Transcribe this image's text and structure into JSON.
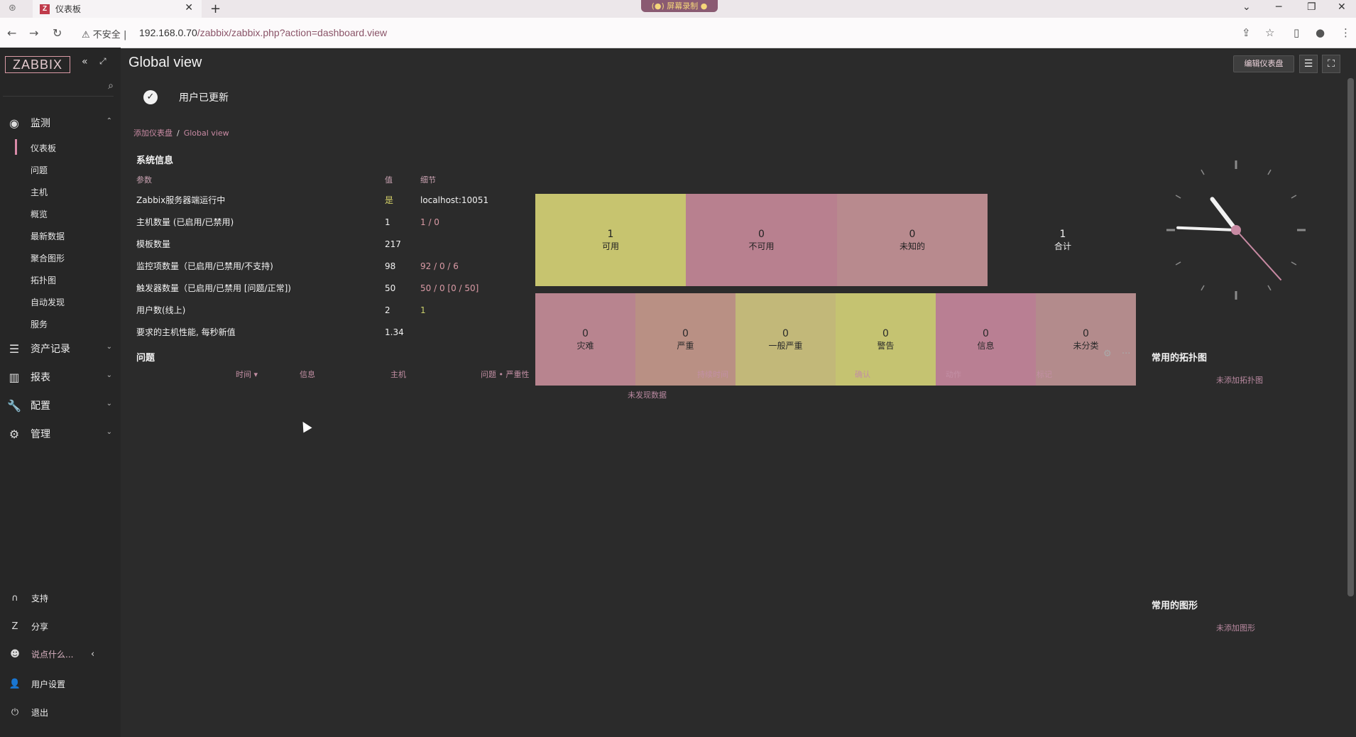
{
  "browser": {
    "tab_title": "仪表板",
    "tab_icon": "Z",
    "address_warning": "不安全",
    "url_host": "192.168.0.70",
    "url_path": "/zabbix/zabbix.php?action=dashboard.view",
    "recording_label": "(●) 屏幕录制 ●"
  },
  "sidebar": {
    "logo": "ZABBIX",
    "sections": [
      {
        "label": "监测",
        "icon": "eye-icon"
      },
      {
        "label": "资产记录",
        "icon": "list-icon"
      },
      {
        "label": "报表",
        "icon": "bar-chart-icon"
      },
      {
        "label": "配置",
        "icon": "wrench-icon"
      },
      {
        "label": "管理",
        "icon": "gear-icon"
      }
    ],
    "monitoring_items": [
      "仪表板",
      "问题",
      "主机",
      "概览",
      "最新数据",
      "聚合图形",
      "拓扑图",
      "自动发现",
      "服务"
    ],
    "footer": [
      {
        "label": "支持",
        "icon": "headset-icon"
      },
      {
        "label": "分享",
        "icon": "share-icon"
      },
      {
        "label": "说点什么...",
        "icon": "smile-icon"
      },
      {
        "label": "用户设置",
        "icon": "user-icon"
      },
      {
        "label": "退出",
        "icon": "power-icon"
      }
    ]
  },
  "header": {
    "title": "Global view",
    "edit_button": "编辑仪表盘"
  },
  "message": {
    "text": "用户已更新"
  },
  "breadcrumb": {
    "parent": "添加仪表盘",
    "current": "Global view"
  },
  "system_info": {
    "title": "系统信息",
    "headers": [
      "参数",
      "值",
      "细节"
    ],
    "rows": [
      {
        "param": "Zabbix服务器端运行中",
        "value": "是",
        "detail": "localhost:10051"
      },
      {
        "param": "主机数量 (已启用/已禁用)",
        "value": "1",
        "detail": "1 / 0"
      },
      {
        "param": "模板数量",
        "value": "217",
        "detail": ""
      },
      {
        "param": "监控项数量（已启用/已禁用/不支持)",
        "value": "98",
        "detail": "92 / 0 / 6"
      },
      {
        "param": "触发器数量（已启用/已禁用 [问题/正常])",
        "value": "50",
        "detail": "50 / 0 [0 / 50]"
      },
      {
        "param": "用户数(线上)",
        "value": "2",
        "detail": "1"
      },
      {
        "param": "要求的主机性能, 每秒新值",
        "value": "1.34",
        "detail": ""
      }
    ]
  },
  "host_availability": {
    "cells": [
      {
        "count": "1",
        "label": "可用",
        "color": "#c7c46f"
      },
      {
        "count": "0",
        "label": "不可用",
        "color": "#b8808f"
      },
      {
        "count": "0",
        "label": "未知的",
        "color": "#b88a8e"
      },
      {
        "count": "1",
        "label": "合计",
        "color": "#2b2b2b"
      }
    ]
  },
  "problems_by_severity": {
    "cells": [
      {
        "count": "0",
        "label": "灾难",
        "color": "#b8848f"
      },
      {
        "count": "0",
        "label": "严重",
        "color": "#b99084"
      },
      {
        "count": "0",
        "label": "一般严重",
        "color": "#c2b879"
      },
      {
        "count": "0",
        "label": "警告",
        "color": "#c5c371"
      },
      {
        "count": "0",
        "label": "信息",
        "color": "#b97f93"
      },
      {
        "count": "0",
        "label": "未分类",
        "color": "#b38b8c"
      }
    ]
  },
  "problems": {
    "title": "问题",
    "columns": [
      "时间 ▾",
      "信息",
      "主机",
      "问题 • 严重性",
      "持续时间",
      "确认",
      "动作",
      "标记"
    ],
    "no_data": "未发现数据"
  },
  "favorite_maps": {
    "title": "常用的拓扑图",
    "empty": "未添加拓扑图"
  },
  "favorite_graphs": {
    "title": "常用的图形",
    "empty": "未添加图形"
  },
  "clock": {
    "hour": 10,
    "minute": 45,
    "second": 23
  }
}
